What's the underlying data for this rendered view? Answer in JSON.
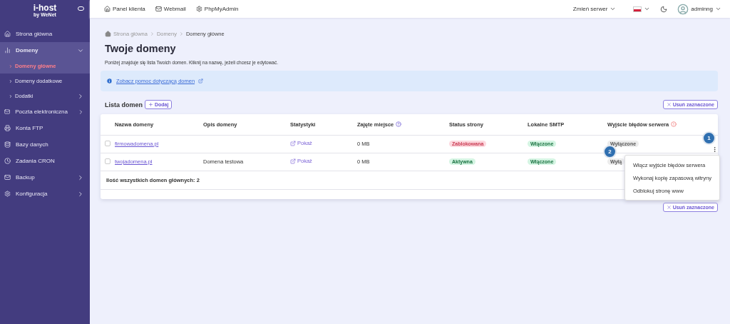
{
  "sidebar": {
    "logo": {
      "title": "i-host",
      "subtitle": "by WeNet"
    },
    "items": [
      {
        "label": "Strona główna",
        "selected": false
      },
      {
        "label": "Domeny",
        "selected": true,
        "expanded": true,
        "children": [
          {
            "label": "Domeny główne",
            "selected": true
          },
          {
            "label": "Domeny dodatkowe",
            "selected": false
          },
          {
            "label": "Dodatki",
            "selected": false,
            "expanded": false
          }
        ]
      },
      {
        "label": "Poczta elektroniczna",
        "selected": false,
        "expanded": false
      },
      {
        "label": "Konta FTP",
        "selected": false
      },
      {
        "label": "Bazy danych",
        "selected": false
      },
      {
        "label": "Zadania CRON",
        "selected": false
      },
      {
        "label": "Backup",
        "selected": false,
        "expanded": false
      },
      {
        "label": "Konfiguracja",
        "selected": false,
        "expanded": false
      }
    ]
  },
  "topbar": {
    "links": [
      "Panel klienta",
      "Webmail",
      "PhpMyAdmin"
    ],
    "server": "Zmień serwer",
    "user": "adminng"
  },
  "breadcrumb": [
    "Strona główna",
    "Domeny",
    "Domeny główne"
  ],
  "title": "Twoje domeny",
  "description": "Poniżej znajduje się lista Twoich domen. Kliknij na nazwę, jeżeli chcesz je edytować.",
  "info_link": "Zobacz pomoc dotyczącą domen",
  "list_title": "Lista domen",
  "add_button": "Dodaj",
  "remove_button": "Usuń zaznaczone",
  "remove_button_bottom": "Usuń zaznaczone",
  "table": {
    "columns": [
      "Nazwa domeny",
      "Opis domeny",
      "Statystyki",
      "Zajęte miejsce",
      "Status strony",
      "Lokalne SMTP",
      "Wyjście błędów serwera"
    ],
    "rows": [
      {
        "checked": false,
        "domain": "firmowadomena.pl",
        "description": "",
        "stats": "Pokaż",
        "space": "0 MB",
        "status": {
          "text": "Zablokowana",
          "kind": "danger"
        },
        "smtp": {
          "text": "Włączone",
          "kind": "success"
        },
        "errors": {
          "text": "Wyłączone",
          "kind": "neutral"
        }
      },
      {
        "checked": false,
        "domain": "twojadomena.pl",
        "description": "Domena testowa",
        "stats": "Pokaż",
        "space": "0 MB",
        "status": {
          "text": "Aktywna",
          "kind": "success"
        },
        "smtp": {
          "text": "Włączone",
          "kind": "success"
        },
        "errors": {
          "text": "Wyłą",
          "kind": "neutral"
        }
      }
    ],
    "footer": "Ilość wszystkich domen głównych: 2"
  },
  "menu": [
    "Włącz wyjście błędów serwera",
    "Wykonaj kopię zapasową witryny",
    "Odblokuj stronę www"
  ],
  "markers": [
    "1",
    "2"
  ]
}
